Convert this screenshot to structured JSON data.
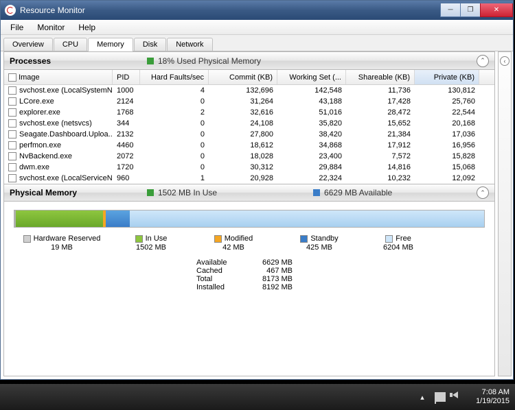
{
  "window": {
    "title": "Resource Monitor"
  },
  "menu": {
    "file": "File",
    "monitor": "Monitor",
    "help": "Help"
  },
  "tabs": {
    "overview": "Overview",
    "cpu": "CPU",
    "memory": "Memory",
    "disk": "Disk",
    "network": "Network"
  },
  "processes": {
    "header": "Processes",
    "stat_label": "18% Used Physical Memory",
    "cols": {
      "image": "Image",
      "pid": "PID",
      "hf": "Hard Faults/sec",
      "commit": "Commit (KB)",
      "ws": "Working Set (...",
      "sh": "Shareable (KB)",
      "pv": "Private (KB)"
    },
    "rows": [
      {
        "image": "svchost.exe (LocalSystemNet...",
        "pid": "1000",
        "hf": "4",
        "commit": "132,696",
        "ws": "142,548",
        "sh": "11,736",
        "pv": "130,812"
      },
      {
        "image": "LCore.exe",
        "pid": "2124",
        "hf": "0",
        "commit": "31,264",
        "ws": "43,188",
        "sh": "17,428",
        "pv": "25,760"
      },
      {
        "image": "explorer.exe",
        "pid": "1768",
        "hf": "2",
        "commit": "32,616",
        "ws": "51,016",
        "sh": "28,472",
        "pv": "22,544"
      },
      {
        "image": "svchost.exe (netsvcs)",
        "pid": "344",
        "hf": "0",
        "commit": "24,108",
        "ws": "35,820",
        "sh": "15,652",
        "pv": "20,168"
      },
      {
        "image": "Seagate.Dashboard.Uploa...",
        "pid": "2132",
        "hf": "0",
        "commit": "27,800",
        "ws": "38,420",
        "sh": "21,384",
        "pv": "17,036"
      },
      {
        "image": "perfmon.exe",
        "pid": "4460",
        "hf": "0",
        "commit": "18,612",
        "ws": "34,868",
        "sh": "17,912",
        "pv": "16,956"
      },
      {
        "image": "NvBackend.exe",
        "pid": "2072",
        "hf": "0",
        "commit": "18,028",
        "ws": "23,400",
        "sh": "7,572",
        "pv": "15,828"
      },
      {
        "image": "dwm.exe",
        "pid": "1720",
        "hf": "0",
        "commit": "30,312",
        "ws": "29,884",
        "sh": "14,816",
        "pv": "15,068"
      },
      {
        "image": "svchost.exe (LocalServiceNet...",
        "pid": "960",
        "hf": "1",
        "commit": "20,928",
        "ws": "22,324",
        "sh": "10,232",
        "pv": "12,092"
      }
    ]
  },
  "physmem": {
    "header": "Physical Memory",
    "inuse_label": "1502 MB In Use",
    "avail_label": "6629 MB Available",
    "legend": {
      "hw": {
        "name": "Hardware Reserved",
        "val": "19 MB"
      },
      "use": {
        "name": "In Use",
        "val": "1502 MB"
      },
      "mod": {
        "name": "Modified",
        "val": "42 MB"
      },
      "sby": {
        "name": "Standby",
        "val": "425 MB"
      },
      "free": {
        "name": "Free",
        "val": "6204 MB"
      }
    },
    "stats": {
      "available": {
        "lab": "Available",
        "val": "6629 MB"
      },
      "cached": {
        "lab": "Cached",
        "val": "467 MB"
      },
      "total": {
        "lab": "Total",
        "val": "8173 MB"
      },
      "installed": {
        "lab": "Installed",
        "val": "8192 MB"
      }
    }
  },
  "taskbar": {
    "time": "7:08 AM",
    "date": "1/19/2015"
  }
}
